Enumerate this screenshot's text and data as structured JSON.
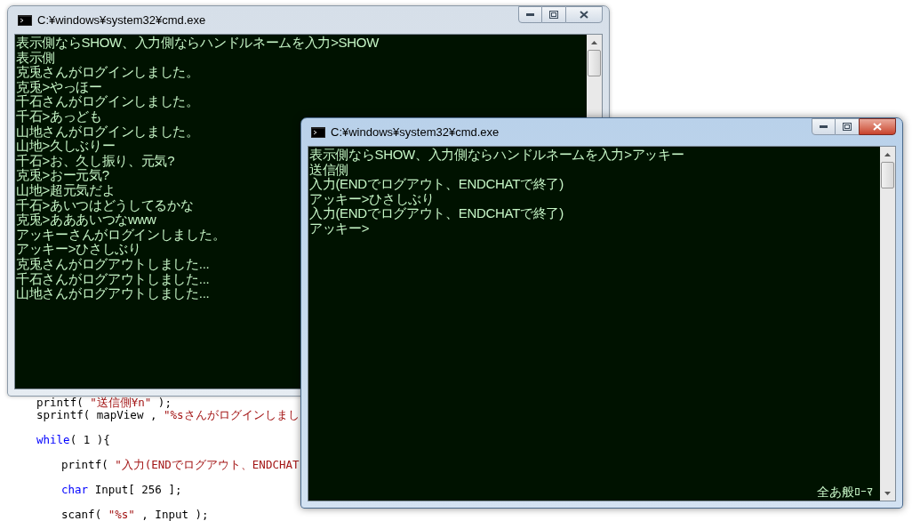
{
  "editor": {
    "blocks": [
      [
        {
          "indented": false,
          "tokens": [
            {
              "kind": "plain",
              "text": "printf( "
            },
            {
              "kind": "string",
              "text": "\"送信側¥n\""
            },
            {
              "kind": "plain",
              "text": " );"
            }
          ]
        },
        {
          "indented": false,
          "tokens": [
            {
              "kind": "plain",
              "text": "sprintf( mapView , "
            },
            {
              "kind": "string",
              "text": "\"%sさんがログインしまし"
            }
          ]
        }
      ],
      [
        {
          "indented": false,
          "tokens": [
            {
              "kind": "keyword",
              "text": "while"
            },
            {
              "kind": "plain",
              "text": "( 1 ){"
            }
          ]
        }
      ],
      [
        {
          "indented": true,
          "tokens": [
            {
              "kind": "plain",
              "text": "printf( "
            },
            {
              "kind": "string",
              "text": "\"入力(ENDでログアウト、ENDCHAT"
            }
          ]
        }
      ],
      [
        {
          "indented": true,
          "tokens": [
            {
              "kind": "keyword",
              "text": "char"
            },
            {
              "kind": "plain",
              "text": " Input[ 256 ];"
            }
          ]
        }
      ],
      [
        {
          "indented": true,
          "tokens": [
            {
              "kind": "plain",
              "text": "scanf( "
            },
            {
              "kind": "string",
              "text": "\"%s\""
            },
            {
              "kind": "plain",
              "text": " , Input );"
            }
          ]
        }
      ]
    ]
  },
  "windows": [
    {
      "title": "C:¥windows¥system32¥cmd.exe",
      "active": false,
      "lines": [
        "表示側ならSHOW、入力側ならハンドルネームを入力>SHOW",
        "表示側",
        "克兎さんがログインしました。",
        "克兎>やっほー",
        "千石さんがログインしました。",
        "千石>あっども",
        "山地さんがログインしました。",
        "山地>久しぶりー",
        "千石>お、久し振り、元気?",
        "克兎>おー元気?",
        "山地>超元気だよ",
        "千石>あいつはどうしてるかな",
        "克兎>あああいつなwww",
        "アッキーさんがログインしました。",
        "アッキー>ひさしぶり",
        "克兎さんがログアウトしました...",
        "千石さんがログアウトしました...",
        "山地さんがログアウトしました..."
      ]
    },
    {
      "title": "C:¥windows¥system32¥cmd.exe",
      "active": true,
      "lines": [
        "表示側ならSHOW、入力側ならハンドルネームを入力>アッキー",
        "送信側",
        "入力(ENDでログアウト、ENDCHATで終了)",
        "アッキー>ひさしぶり",
        "入力(ENDでログアウト、ENDCHATで終了)",
        "アッキー>"
      ],
      "ime_status": "全あ般ﾛｰﾏ"
    }
  ]
}
